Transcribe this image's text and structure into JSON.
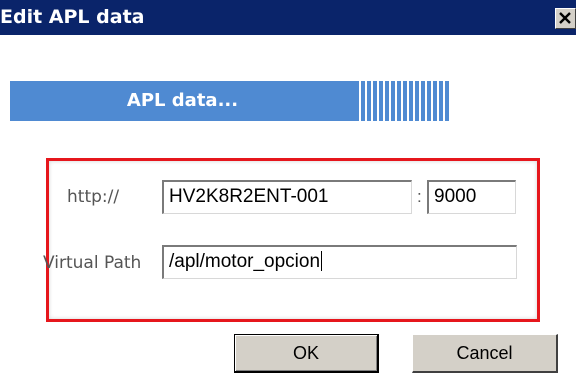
{
  "window": {
    "title": "Edit APL data",
    "close_glyph": "✕"
  },
  "banner": {
    "text": "APL data..."
  },
  "form": {
    "host_label": "http://",
    "host_value": "HV2K8R2ENT-001",
    "port_separator": ":",
    "port_value": "9000",
    "path_label": "Virtual Path",
    "path_value": "/apl/motor_opcion"
  },
  "buttons": {
    "ok_label": "OK",
    "cancel_label": "Cancel"
  },
  "colors": {
    "titlebar": "#0a246a",
    "banner": "#4f8ad2",
    "highlight_border": "#e6161c",
    "button_face": "#d4d0c8"
  },
  "icons": {
    "close": "close-icon"
  }
}
